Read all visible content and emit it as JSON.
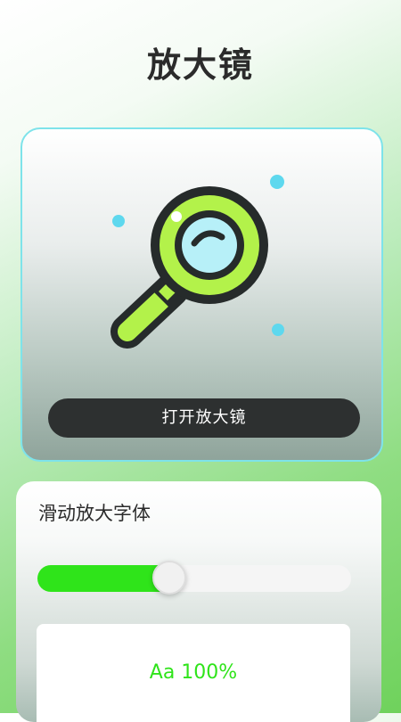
{
  "header": {
    "title": "放大镜"
  },
  "magnifier_card": {
    "icon": "magnifying-glass-icon",
    "open_button_label": "打开放大镜"
  },
  "font_card": {
    "title": "滑动放大字体",
    "slider": {
      "value_fraction": 0.42
    },
    "preview_text": "Aa 100%"
  },
  "colors": {
    "accent_green": "#2fe41a",
    "button_dark": "#2d3030",
    "lens_blue": "#b7f0f8",
    "frame_lime": "#b3f24a",
    "dot_cyan": "#5ed8ee"
  }
}
